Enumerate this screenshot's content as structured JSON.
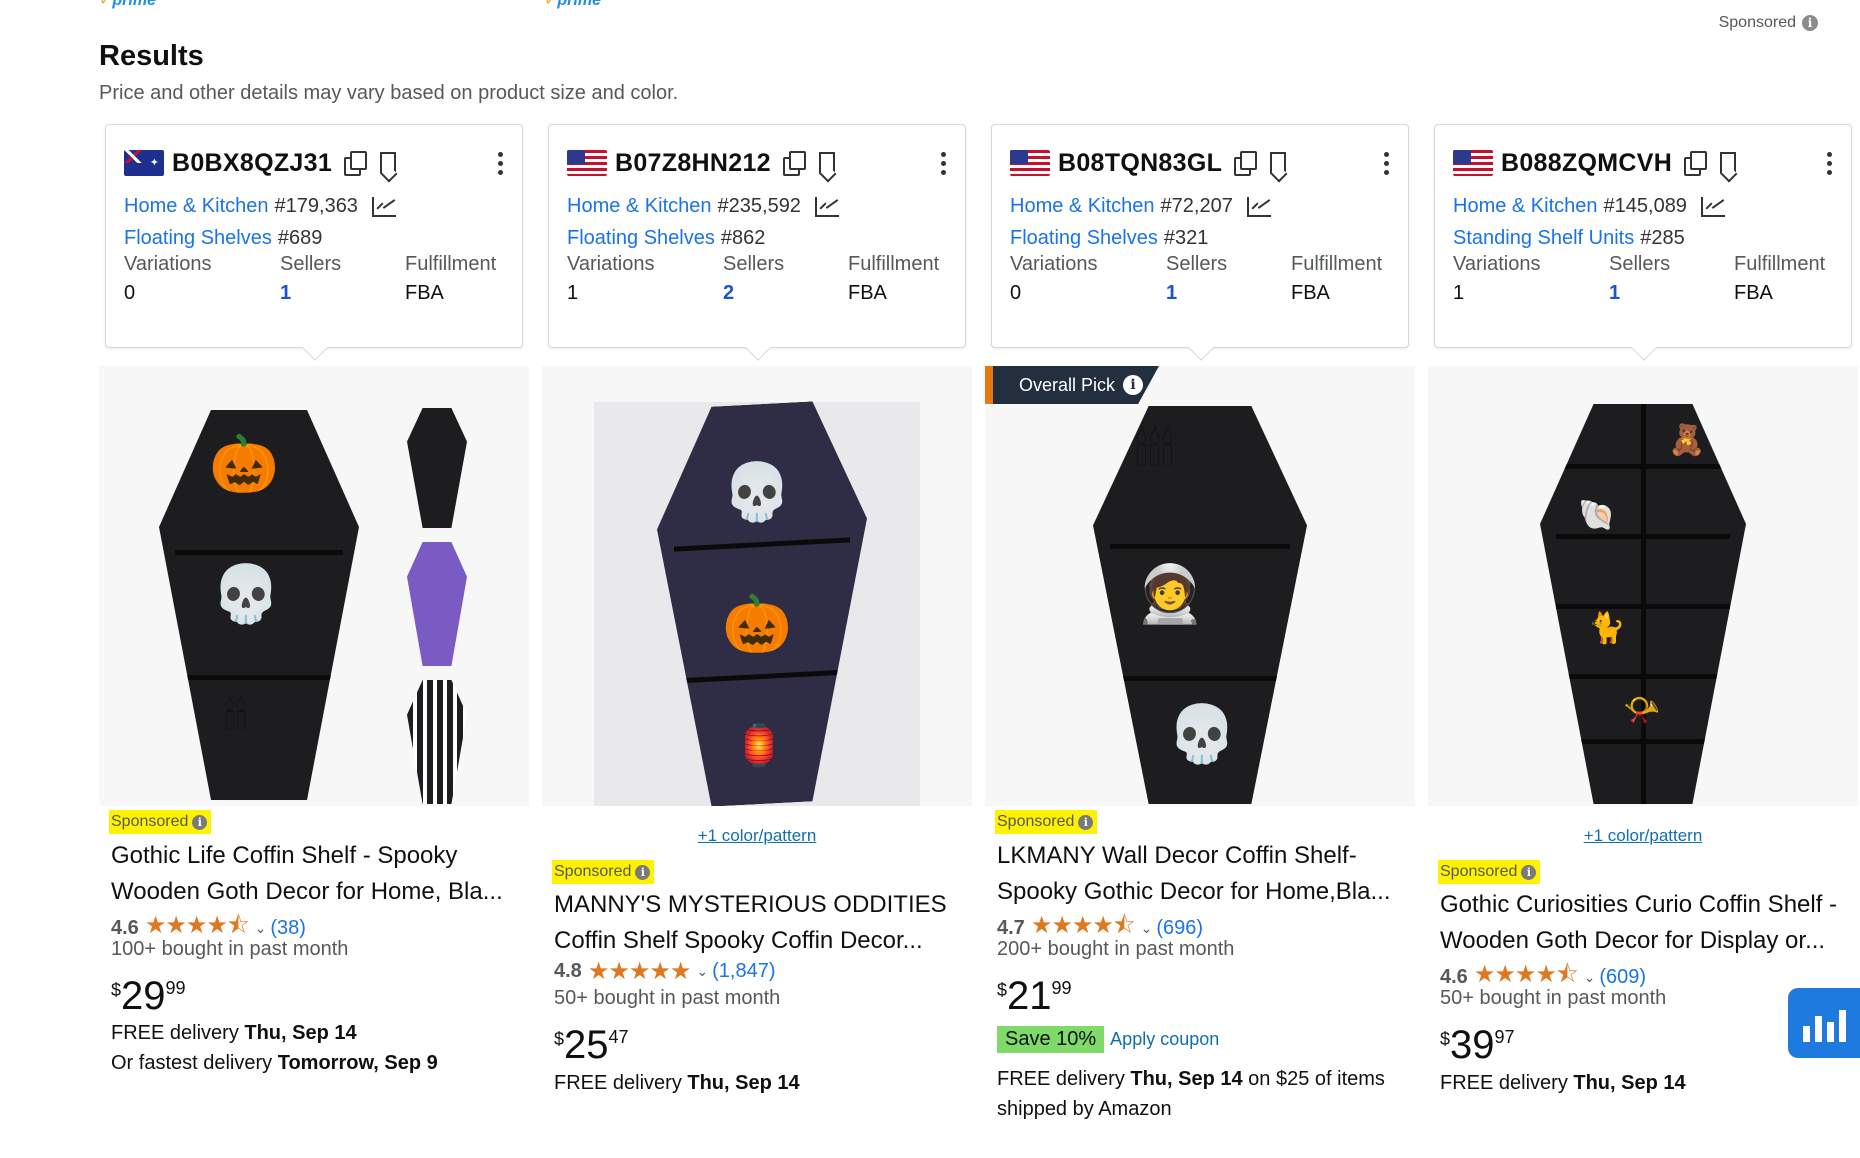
{
  "top": {
    "prime_label_1": "prime",
    "prime_label_2": "prime",
    "sponsored_label": "Sponsored"
  },
  "results": {
    "title": "Results",
    "subtitle": "Price and other details may vary based on product size and color."
  },
  "stats_headers": {
    "variations": "Variations",
    "sellers": "Sellers",
    "fulfillment": "Fulfillment"
  },
  "products": [
    {
      "flag": "australia-flag",
      "asin": "B0BX8QZJ31",
      "rank1_cat": "Home & Kitchen",
      "rank1_num": "#179,363",
      "rank2_cat": "Floating Shelves",
      "rank2_num": "#689",
      "variations": "0",
      "sellers": "1",
      "fulfillment": "FBA",
      "sponsored": "Sponsored",
      "title": "Gothic Life Coffin Shelf - Spooky Wooden Goth Decor for Home, Bla...",
      "rating": "4.6",
      "stars": "★★★★⯪",
      "reviews": "(38)",
      "bought": "100+ bought in past month",
      "price_symbol": "$",
      "price_whole": "29",
      "price_fraction": "99",
      "delivery_prefix": "FREE delivery ",
      "delivery_date": "Thu, Sep 14",
      "fastest_prefix": "Or fastest delivery ",
      "fastest_date": "Tomorrow, Sep 9"
    },
    {
      "flag": "us-flag",
      "asin": "B07Z8HN212",
      "rank1_cat": "Home & Kitchen",
      "rank1_num": "#235,592",
      "rank2_cat": "Floating Shelves",
      "rank2_num": "#862",
      "variations": "1",
      "sellers": "2",
      "fulfillment": "FBA",
      "color_link": "+1 color/pattern",
      "sponsored": "Sponsored",
      "title": "MANNY'S MYSTERIOUS ODDITIES Coffin Shelf Spooky Coffin Decor...",
      "rating": "4.8",
      "stars": "★★★★★",
      "reviews": "(1,847)",
      "bought": "50+ bought in past month",
      "price_symbol": "$",
      "price_whole": "25",
      "price_fraction": "47",
      "delivery_prefix": "FREE delivery ",
      "delivery_date": "Thu, Sep 14"
    },
    {
      "flag": "us-flag",
      "asin": "B08TQN83GL",
      "rank1_cat": "Home & Kitchen",
      "rank1_num": "#72,207",
      "rank2_cat": "Floating Shelves",
      "rank2_num": "#321",
      "variations": "0",
      "sellers": "1",
      "fulfillment": "FBA",
      "badge": "Overall Pick",
      "sponsored": "Sponsored",
      "title": "LKMANY Wall Decor Coffin Shelf-Spooky Gothic Decor for Home,Bla...",
      "rating": "4.7",
      "stars": "★★★★⯪",
      "reviews": "(696)",
      "bought": "200+ bought in past month",
      "price_symbol": "$",
      "price_whole": "21",
      "price_fraction": "99",
      "coupon_badge": "Save 10%",
      "coupon_apply": "Apply coupon",
      "delivery_prefix": "FREE delivery ",
      "delivery_date": "Thu, Sep 14",
      "delivery_suffix": " on $25 of items shipped by Amazon"
    },
    {
      "flag": "us-flag",
      "asin": "B088ZQMCVH",
      "rank1_cat": "Home & Kitchen",
      "rank1_num": "#145,089",
      "rank2_cat": "Standing Shelf Units",
      "rank2_num": "#285",
      "variations": "1",
      "sellers": "1",
      "fulfillment": "FBA",
      "color_link": "+1 color/pattern",
      "sponsored": "Sponsored",
      "title": "Gothic Curiosities Curio Coffin Shelf - Wooden Goth Decor for Display or...",
      "rating": "4.6",
      "stars": "★★★★⯪",
      "reviews": "(609)",
      "bought": "50+ bought in past month",
      "price_symbol": "$",
      "price_whole": "39",
      "price_fraction": "97",
      "delivery_prefix": "FREE delivery ",
      "delivery_date": "Thu, Sep 14"
    }
  ],
  "colors": {
    "link_blue": "#1a73e8",
    "star_orange": "#de7921",
    "sponsored_highlight": "#fff200",
    "coupon_green": "#7fda69",
    "badge_dark": "#232f3e",
    "badge_accent": "#e47911",
    "floating_button": "#1f7ae0"
  }
}
